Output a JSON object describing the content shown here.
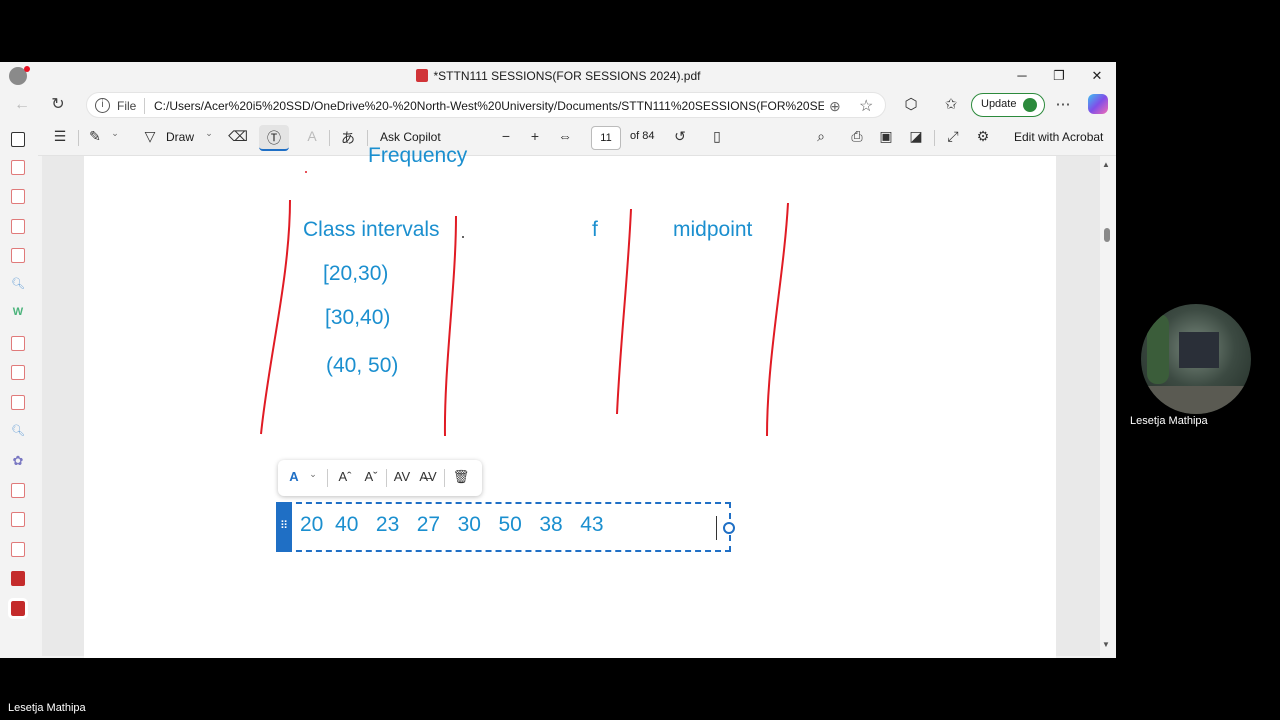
{
  "window": {
    "title": "*STTN111 SESSIONS(FOR SESSIONS 2024).pdf",
    "minimize": "─",
    "maximize": "❐",
    "close": "✕"
  },
  "address": {
    "scheme_label": "File",
    "url": "C:/Users/Acer%20i5%20SSD/OneDrive%20-%20North-West%20University/Documents/STTN111%20SESSIONS(FOR%20SESSIONS...",
    "update_label": "Update"
  },
  "toolbar": {
    "draw_label": "Draw",
    "ask_copilot_label": "Ask Copilot",
    "page_current": "11",
    "page_total": "of 84",
    "edit_with_acrobat_label": "Edit with Acrobat"
  },
  "document": {
    "partial_heading": "Frequency",
    "headers": {
      "class_intervals": "Class intervals",
      "f": "f",
      "midpoint": "midpoint"
    },
    "intervals": [
      "[20,30)",
      "[30,40)",
      "(40, 50)"
    ],
    "textbox_content": "20  40   23   27   30   50   38   43"
  },
  "participants": {
    "video_name": "Lesetja Mathipa",
    "bottom_name": "Lesetja Mathipa"
  },
  "colors": {
    "text_blue": "#1b8fcf",
    "selection_blue": "#1f6fc5",
    "ink_red": "#e01b24",
    "update_green": "#2c8a3c"
  }
}
